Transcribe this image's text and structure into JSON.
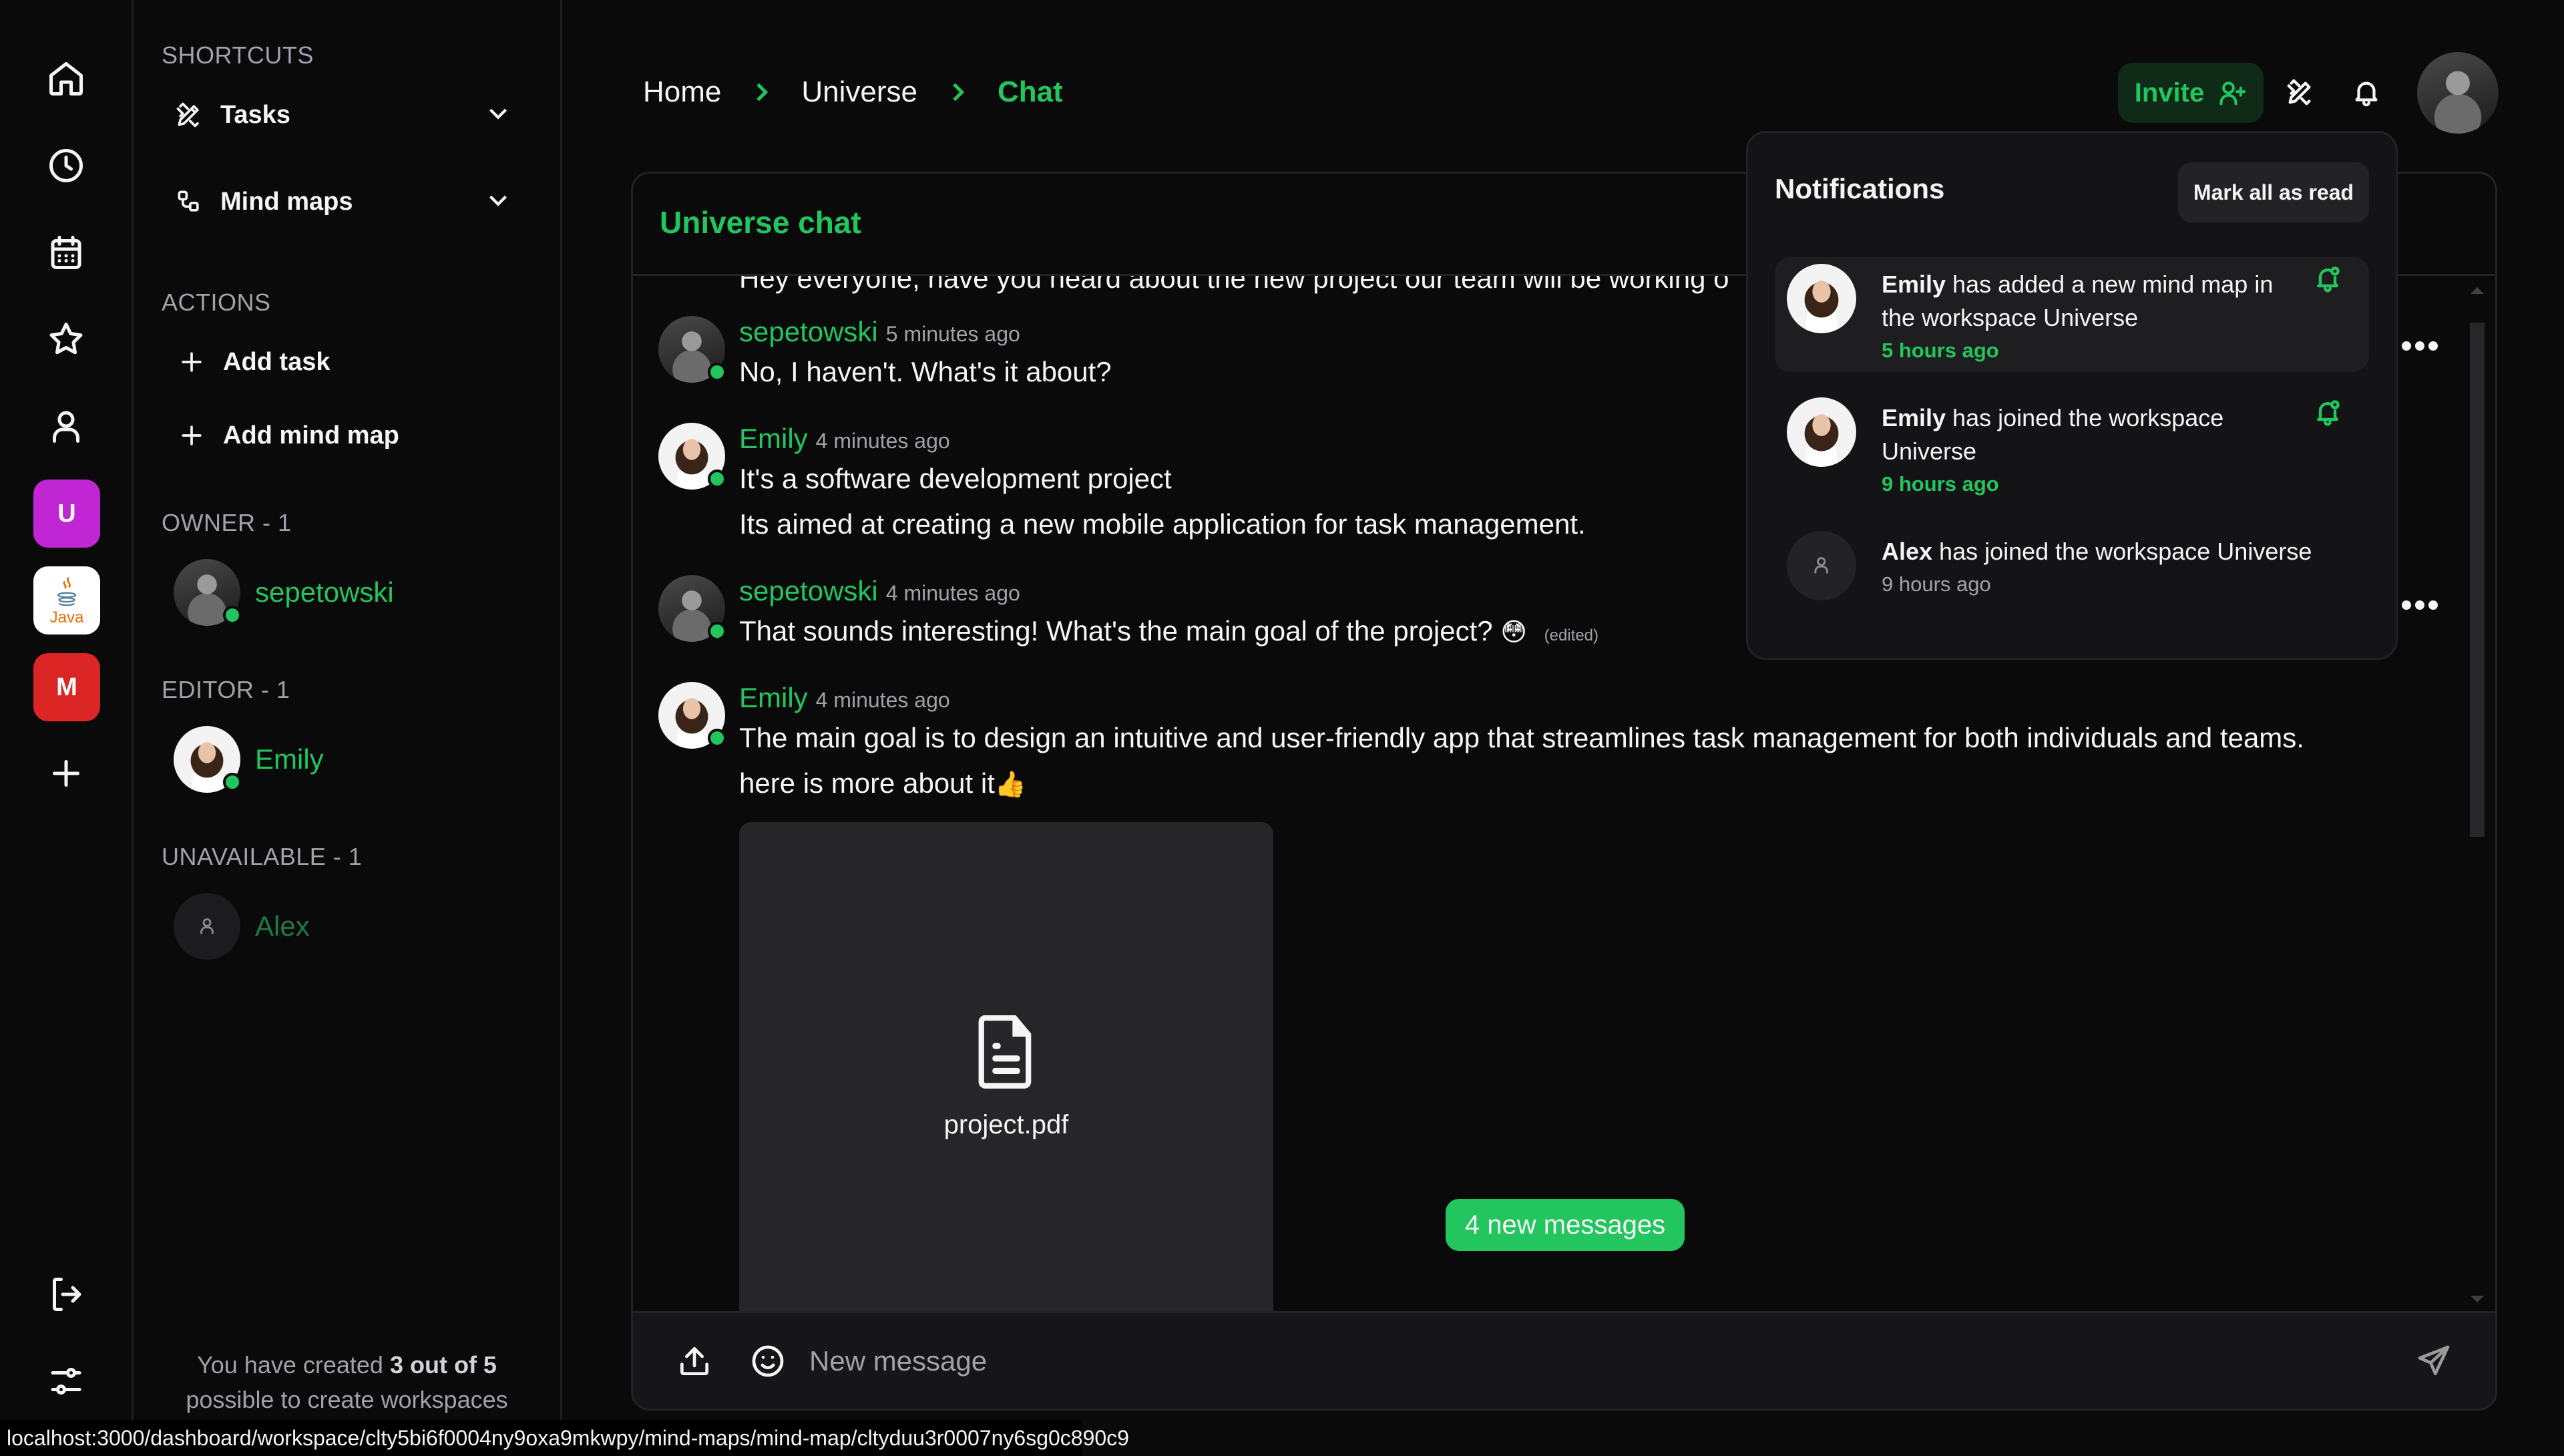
{
  "rail": {
    "nav_icons": [
      "home-icon",
      "clock-icon",
      "calendar-icon",
      "star-icon",
      "user-icon"
    ],
    "workspaces": [
      {
        "label": "U",
        "color": "#c026d3"
      },
      {
        "label": "Java",
        "color": "#ffffff"
      },
      {
        "label": "M",
        "color": "#dc2626"
      }
    ],
    "add_workspace": "+",
    "bottom_icons": [
      "logout-icon",
      "settings-sliders-icon"
    ]
  },
  "sidebar": {
    "shortcuts_heading": "SHORTCUTS",
    "shortcuts": [
      {
        "label": "Tasks",
        "icon": "pencil-ruler-icon"
      },
      {
        "label": "Mind maps",
        "icon": "workflow-icon"
      }
    ],
    "actions_heading": "ACTIONS",
    "actions": [
      {
        "label": "Add task",
        "icon": "plus-icon"
      },
      {
        "label": "Add mind map",
        "icon": "plus-icon"
      }
    ],
    "groups": [
      {
        "heading": "OWNER - 1",
        "member": "sepetowski",
        "online": true
      },
      {
        "heading": "EDITOR - 1",
        "member": "Emily",
        "online": true
      },
      {
        "heading": "UNAVAILABLE - 1",
        "member": "Alex",
        "online": false
      }
    ],
    "footer": {
      "prefix": "You have created ",
      "count": "3 out of 5",
      "suffix": "possible to create workspaces"
    }
  },
  "header": {
    "breadcrumb": [
      "Home",
      "Universe",
      "Chat"
    ],
    "invite_label": "Invite"
  },
  "chat": {
    "title": "Universe chat",
    "cut_message": "Hey everyone, have you heard about the new project our team will be working o",
    "messages": [
      {
        "author": "sepetowski",
        "time": "5 minutes ago",
        "lines": [
          "No, I haven't. What's it about?"
        ]
      },
      {
        "author": "Emily",
        "time": "4 minutes ago",
        "lines": [
          "It's a software development project",
          "Its aimed at creating a new mobile application for task management."
        ]
      },
      {
        "author": "sepetowski",
        "time": "4 minutes ago",
        "lines": [
          "That sounds interesting! What's the main goal of the project?"
        ],
        "emoji": "😳",
        "edited": "(edited)"
      },
      {
        "author": "Emily",
        "time": "4 minutes ago",
        "lines": [
          "The main goal is to design an intuitive and user-friendly app that streamlines task management for both individuals and teams.",
          "here is more about it"
        ],
        "emoji": "👍",
        "attachment": "project.pdf"
      }
    ],
    "new_messages_label": "4 new messages",
    "composer_placeholder": "New message"
  },
  "notifications": {
    "title": "Notifications",
    "mark_all_label": "Mark all as read",
    "items": [
      {
        "actor": "Emily",
        "text": " has added a new mind map in the workspace Universe",
        "time": "5 hours ago",
        "unread": true
      },
      {
        "actor": "Emily",
        "text": " has joined the workspace Universe",
        "time": "9 hours ago",
        "unread": true
      },
      {
        "actor": "Alex",
        "text": " has joined the workspace Universe",
        "time": "9 hours ago",
        "unread": false
      }
    ]
  },
  "status_bar": {
    "url": "localhost:3000/dashboard/workspace/clty5bi6f0004ny9oxa9mkwpy/mind-maps/mind-map/cltyduu3r0007ny6sg0c890c9"
  },
  "colors": {
    "accent": "#22c55e",
    "background": "#0a0a0a",
    "panel": "#141416",
    "muted_text": "#a1a1aa"
  }
}
